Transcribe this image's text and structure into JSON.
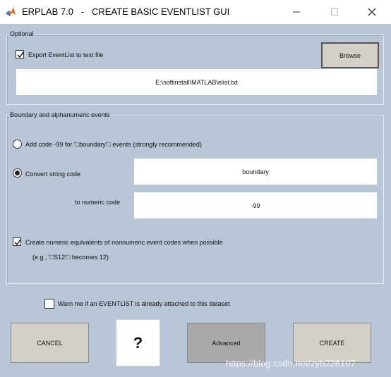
{
  "window": {
    "title": "ERPLAB 7.0   -   CREATE BASIC EVENTLIST GUI",
    "icons": [
      "matlab-icon",
      "minimize-icon",
      "maximize-icon",
      "close-icon"
    ]
  },
  "optional_panel": {
    "title": "Optional",
    "export_label": "Export EventList to text file",
    "export_checked": true,
    "browse_label": "Browse",
    "file_path": "E:\\softinstall\\MATLAB\\elist.txt"
  },
  "boundary_panel": {
    "title": "Boundary and alphanumeric events",
    "add_code_label": "Add code -99 for '□boundary'□ events (strongly recommended)",
    "add_code_selected": false,
    "convert_label": "Convert string code",
    "convert_selected": true,
    "string_code_value": "boundary",
    "to_numeric_label": "to numeric code",
    "numeric_code_value": "-99",
    "create_equiv_label": "Create numeric equivalents of nonnumeric event codes when possible",
    "create_equiv_checked": true,
    "example_text": "(e.g., '□S12'□ becomes 12)"
  },
  "warn": {
    "label": "Warn me if an EVENTLIST is already attached to this dataset",
    "checked": false
  },
  "buttons": {
    "cancel": "CANCEL",
    "help": "?",
    "advanced": "Advanced",
    "create": "CREATE"
  },
  "watermark": "https://blog.csdn.net/zyb228107",
  "colors": {
    "background": "#b9c6d8",
    "button": "#d4d0c8",
    "advanced_button": "#a9a9a9"
  }
}
